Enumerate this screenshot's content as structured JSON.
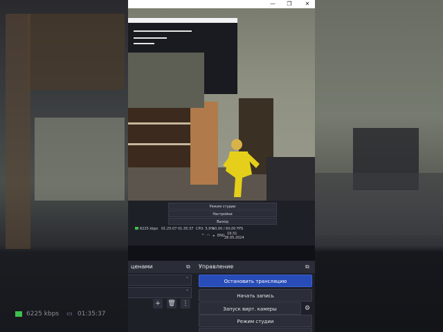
{
  "window": {
    "controls": {
      "minimize": "—",
      "maximize": "❐",
      "close": "✕"
    }
  },
  "ghost_status": {
    "bitrate": "6225 kbps",
    "time": "01:35:37"
  },
  "preview": {
    "mini_buttons": [
      "Режим студии",
      "Настройки",
      "Выход"
    ],
    "mini_status": {
      "bitrate": "6225 kbps",
      "time1": "01:25:07",
      "time2": "01:35:37",
      "cpu": "CPU: 5,9%",
      "fps": "60,00 / 60,00 FPS"
    },
    "tray": {
      "lang": "ENG",
      "clock": "19:31",
      "date": "28.05.2024"
    }
  },
  "scenes_dock": {
    "title": "ценами"
  },
  "controls_dock": {
    "title": "Управление",
    "buttons": {
      "stop_stream": "Остановить трансляцию",
      "start_record": "Начать запись",
      "virtual_cam": "Запуск вирт. камеры",
      "studio_mode": "Режим студии"
    }
  },
  "colors": {
    "accent": "#284cb8",
    "panel": "#1e2028",
    "bitrate_ok": "#3fbf4f"
  }
}
